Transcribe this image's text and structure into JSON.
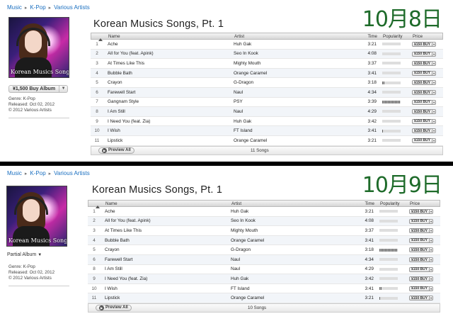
{
  "panels": [
    {
      "breadcrumb": [
        "Music",
        "K-Pop",
        "Various Artists"
      ],
      "date_label": "10月8日",
      "album_title": "Korean Musics Songs, Pt. 1",
      "cover_text": "Korean Musics Songs",
      "buy_label": "¥1,500 Buy Album",
      "partial_label": "",
      "meta": {
        "genre": "Genre: K-Pop",
        "released": "Released: Oct 02, 2012",
        "copyright": "© 2012 Various Artists"
      },
      "headers": {
        "name": "Name",
        "artist": "Artist",
        "time": "Time",
        "popularity": "Popularity",
        "price": "Price"
      },
      "tracks": [
        {
          "n": "1",
          "name": "Ache",
          "artist": "Huh Gak",
          "time": "3:21",
          "popularity": 0.0,
          "price": "¥150 BUY"
        },
        {
          "n": "2",
          "name": "All for You (feat. Apink)",
          "artist": "Seo In Kook",
          "time": "4:08",
          "popularity": 0.0,
          "price": "¥150 BUY"
        },
        {
          "n": "3",
          "name": "At Times Like This",
          "artist": "Mighty Mouth",
          "time": "3:37",
          "popularity": 0.0,
          "price": "¥150 BUY"
        },
        {
          "n": "4",
          "name": "Bubble Bath",
          "artist": "Orange Caramel",
          "time": "3:41",
          "popularity": 0.0,
          "price": "¥150 BUY"
        },
        {
          "n": "5",
          "name": "Crayon",
          "artist": "G-Dragon",
          "time": "3:18",
          "popularity": 0.12,
          "price": "¥150 BUY"
        },
        {
          "n": "6",
          "name": "Farewell Start",
          "artist": "Naul",
          "time": "4:34",
          "popularity": 0.0,
          "price": "¥150 BUY"
        },
        {
          "n": "7",
          "name": "Gangnam Style",
          "artist": "PSY",
          "time": "3:39",
          "popularity": 0.95,
          "price": "¥150 BUY"
        },
        {
          "n": "8",
          "name": "I Am Still",
          "artist": "Naul",
          "time": "4:29",
          "popularity": 0.0,
          "price": "¥150 BUY"
        },
        {
          "n": "9",
          "name": "I Need You (feat. Zia)",
          "artist": "Huh Gak",
          "time": "3:42",
          "popularity": 0.0,
          "price": "¥150 BUY"
        },
        {
          "n": "10",
          "name": "I Wish",
          "artist": "FT Island",
          "time": "3:41",
          "popularity": 0.05,
          "price": "¥150 BUY"
        },
        {
          "n": "11",
          "name": "Lipstick",
          "artist": "Orange Caramel",
          "time": "3:21",
          "popularity": 0.0,
          "price": "¥150 BUY"
        }
      ],
      "preview_label": "Preview All",
      "song_count": "11 Songs"
    },
    {
      "breadcrumb": [
        "Music",
        "K-Pop",
        "Various Artists"
      ],
      "date_label": "10月9日",
      "album_title": "Korean Musics Songs, Pt. 1",
      "cover_text": "Korean Musics Songs",
      "buy_label": "",
      "partial_label": "Partial Album",
      "meta": {
        "genre": "Genre: K-Pop",
        "released": "Released: Oct 02, 2012",
        "copyright": "© 2012 Various Artists"
      },
      "headers": {
        "name": "Name",
        "artist": "Artist",
        "time": "Time",
        "popularity": "Popularity",
        "price": "Price"
      },
      "tracks": [
        {
          "n": "1",
          "name": "Ache",
          "artist": "Huh Gak",
          "time": "3:21",
          "popularity": 0.0,
          "price": "¥150 BUY"
        },
        {
          "n": "2",
          "name": "All for You (feat. Apink)",
          "artist": "Seo In Kook",
          "time": "4:08",
          "popularity": 0.0,
          "price": "¥150 BUY"
        },
        {
          "n": "3",
          "name": "At Times Like This",
          "artist": "Mighty Mouth",
          "time": "3:37",
          "popularity": 0.0,
          "price": "¥150 BUY"
        },
        {
          "n": "4",
          "name": "Bubble Bath",
          "artist": "Orange Caramel",
          "time": "3:41",
          "popularity": 0.0,
          "price": "¥150 BUY"
        },
        {
          "n": "5",
          "name": "Crayon",
          "artist": "G-Dragon",
          "time": "3:18",
          "popularity": 0.95,
          "price": "¥150 BUY"
        },
        {
          "n": "6",
          "name": "Farewell Start",
          "artist": "Naul",
          "time": "4:34",
          "popularity": 0.0,
          "price": "¥150 BUY"
        },
        {
          "n": "8",
          "name": "I Am Still",
          "artist": "Naul",
          "time": "4:29",
          "popularity": 0.0,
          "price": "¥150 BUY"
        },
        {
          "n": "9",
          "name": "I Need You (feat. Zia)",
          "artist": "Huh Gak",
          "time": "3:42",
          "popularity": 0.0,
          "price": "¥150 BUY"
        },
        {
          "n": "10",
          "name": "I Wish",
          "artist": "FT Island",
          "time": "3:41",
          "popularity": 0.12,
          "price": "¥150 BUY"
        },
        {
          "n": "11",
          "name": "Lipstick",
          "artist": "Orange Caramel",
          "time": "3:21",
          "popularity": 0.05,
          "price": "¥150 BUY"
        }
      ],
      "preview_label": "Preview All",
      "song_count": "10 Songs"
    }
  ],
  "colors": {
    "link": "#1a6fc0",
    "date": "#1e6b2a"
  }
}
